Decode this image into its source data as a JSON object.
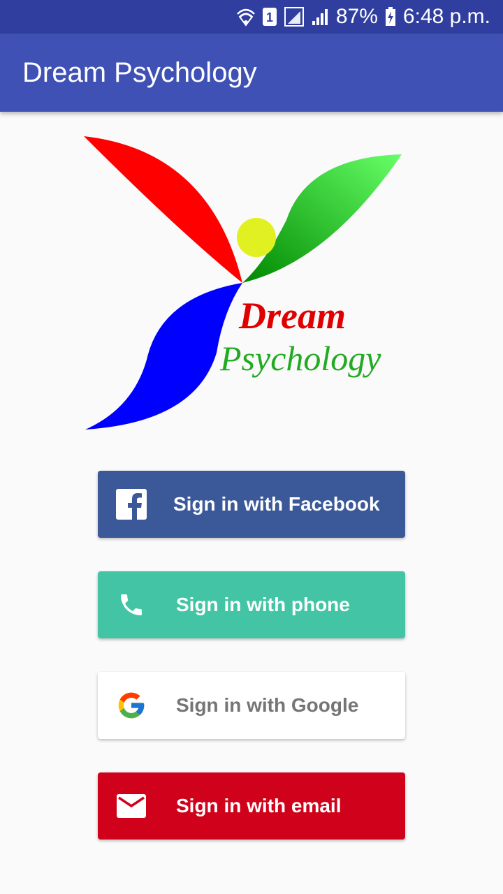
{
  "status_bar": {
    "battery": "87%",
    "time": "6:48 p.m.",
    "sim_slot": "1"
  },
  "app_bar": {
    "title": "Dream Psychology"
  },
  "logo": {
    "line1": "Dream",
    "line2": "Psychology"
  },
  "buttons": {
    "facebook": {
      "label": "Sign in with Facebook",
      "icon": "facebook-icon",
      "color": "#3b5998"
    },
    "phone": {
      "label": "Sign in with phone",
      "icon": "phone-icon",
      "color": "#43c5a5"
    },
    "google": {
      "label": "Sign in with Google",
      "icon": "google-icon",
      "color": "#ffffff"
    },
    "email": {
      "label": "Sign in with email",
      "icon": "mail-icon",
      "color": "#d0021b"
    }
  },
  "colors": {
    "status_bar": "#303f9f",
    "app_bar": "#3f51b5",
    "background": "#fafafa"
  }
}
